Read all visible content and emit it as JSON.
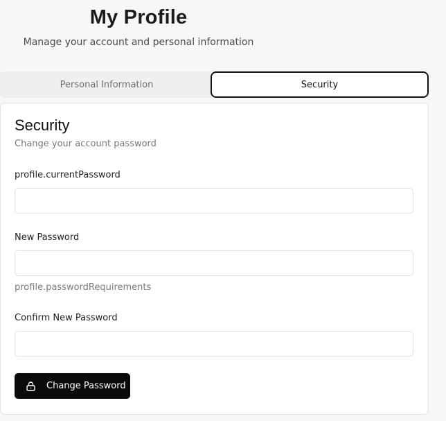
{
  "header": {
    "title": "My Profile",
    "subtitle": "Manage your account and personal information"
  },
  "tabs": [
    {
      "label": "Personal Information",
      "active": false
    },
    {
      "label": "Security",
      "active": true
    }
  ],
  "security": {
    "title": "Security",
    "description": "Change your account password",
    "current_password": {
      "label": "profile.currentPassword",
      "value": "",
      "placeholder": ""
    },
    "new_password": {
      "label": "New Password",
      "value": "",
      "placeholder": "",
      "hint": "profile.passwordRequirements"
    },
    "confirm_password": {
      "label": "Confirm New Password",
      "value": "",
      "placeholder": ""
    },
    "submit_label": "Change Password",
    "submit_icon": "lock-icon"
  },
  "colors": {
    "background": "#f7f7f6",
    "button": "#0b0b0b",
    "active_tab_border": "#111111"
  }
}
